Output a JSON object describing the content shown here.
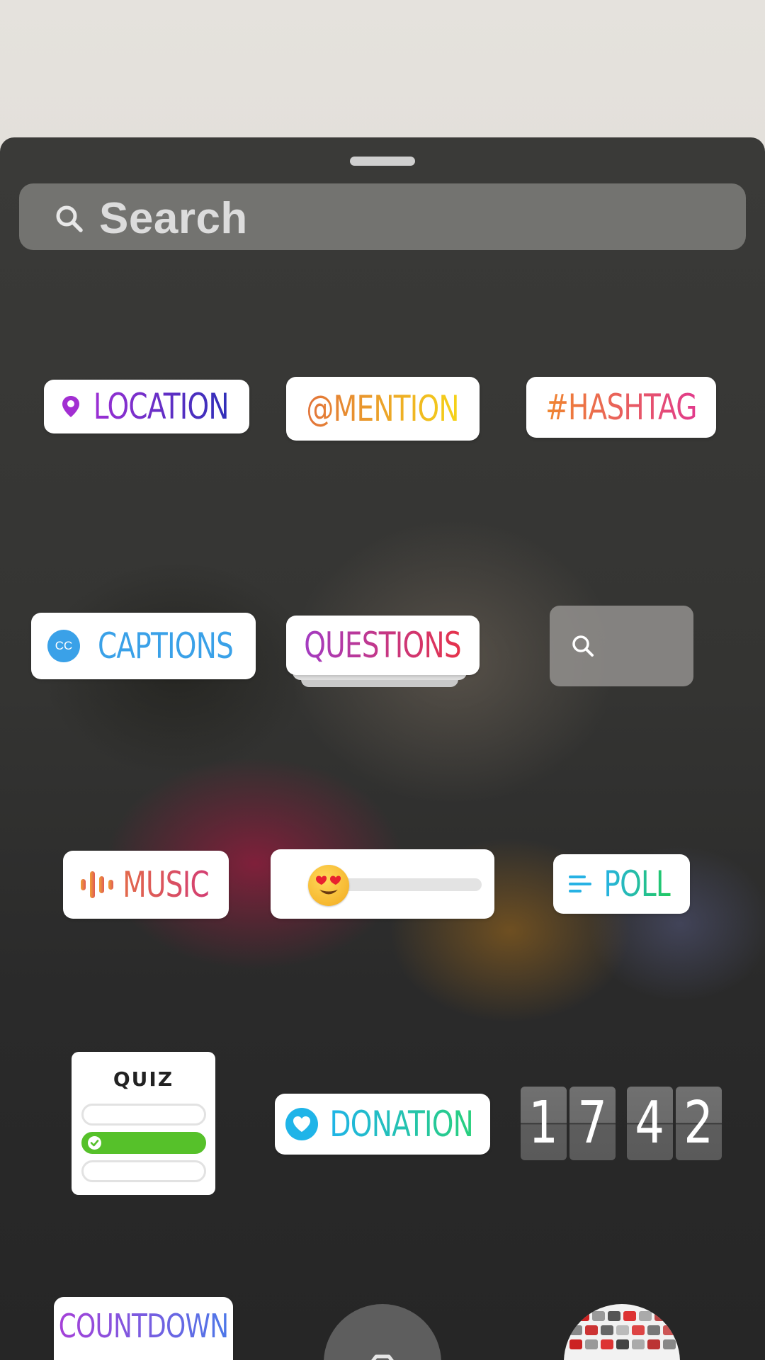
{
  "search": {
    "placeholder": "Search"
  },
  "stickers": {
    "location": "LOCATION",
    "mention": "@MENTION",
    "hashtag": "#HASHTAG",
    "captions": "CAPTIONS",
    "captions_badge": "CC",
    "questions": "QUESTIONS",
    "music": "MUSIC",
    "poll": "POLL",
    "quiz": "QUIZ",
    "donation": "DONATION",
    "countdown": "COUNTDOWN",
    "clock_digits": [
      "1",
      "7",
      "4",
      "2"
    ],
    "emoji_slider_value": 0.1
  },
  "icons": {
    "search": "search-icon",
    "location": "pin-icon",
    "captions": "cc-icon",
    "music": "waveform-icon",
    "poll": "poll-lines-icon",
    "donation": "heart-icon",
    "emoji": "heart-eyes-emoji-icon",
    "camera": "camera-icon",
    "gallery": "gallery-thumbnail"
  },
  "colors": {
    "location": [
      "#9c2fd4",
      "#2f2fb8"
    ],
    "mention": [
      "#e2733a",
      "#f5d318"
    ],
    "hashtag": [
      "#f0862e",
      "#e13a8c"
    ],
    "captions": "#3aa1e8",
    "questions": [
      "#a33bc2",
      "#e6334a"
    ],
    "music": [
      "#f0a035",
      "#d33d72"
    ],
    "poll": [
      "#27b2e4",
      "#22c960"
    ],
    "donation": [
      "#1fb4e8",
      "#29d07c"
    ],
    "countdown": [
      "#a540d8",
      "#4d78e8"
    ],
    "quiz_correct": "#56c12a"
  }
}
